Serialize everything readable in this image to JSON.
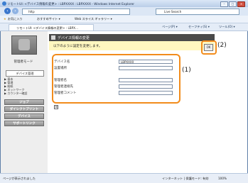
{
  "window": {
    "title": "リモートUI: <デバイス情報の変更> : LBPXXXX : LBPXXXX - Windows Internet Explorer",
    "min": "–",
    "max": "□",
    "close": "✕"
  },
  "address": {
    "url": "http",
    "search_placeholder": "Live Search"
  },
  "favorites": {
    "label": "お気に入り",
    "items": [
      "おすすめサイト ▾",
      "Web スライス ギャラリー ▾"
    ]
  },
  "tab": {
    "label": "リモートUI: <デバイス情報の変更> : LBPX..."
  },
  "commands": [
    "ページ(P) ▾",
    "セーフティ(S) ▾",
    "ツール(O) ▾"
  ],
  "sidebar": {
    "mode": "管理者モード",
    "tab": "デバイス管理",
    "links": [
      "▶ 基本",
      "▶ 管理",
      "▶ 給紙",
      "▶ ネットワーク",
      "▶ カウンター確認"
    ],
    "buttons": [
      "ジョブ",
      "ダイレクトプリント",
      "デバイス",
      "サポートリンク"
    ]
  },
  "page": {
    "header": "デバイス情報の変更",
    "message": "以下のように設定を変更します。",
    "ok": "OK",
    "callout1": "(1)",
    "callout2": "(2)",
    "expand_icon": "⊞"
  },
  "form": {
    "fields": [
      {
        "label": "デバイス名",
        "value": "LBPXXXX"
      },
      {
        "label": "設置場所",
        "value": ""
      },
      {
        "label": "管理者名",
        "value": ""
      },
      {
        "label": "管理者連絡先",
        "value": ""
      },
      {
        "label": "管理者コメント",
        "value": ""
      }
    ]
  },
  "status": {
    "left": "ページが表示されました",
    "right": "インターネット | 保護モード: 有効",
    "zoom": "100%"
  }
}
